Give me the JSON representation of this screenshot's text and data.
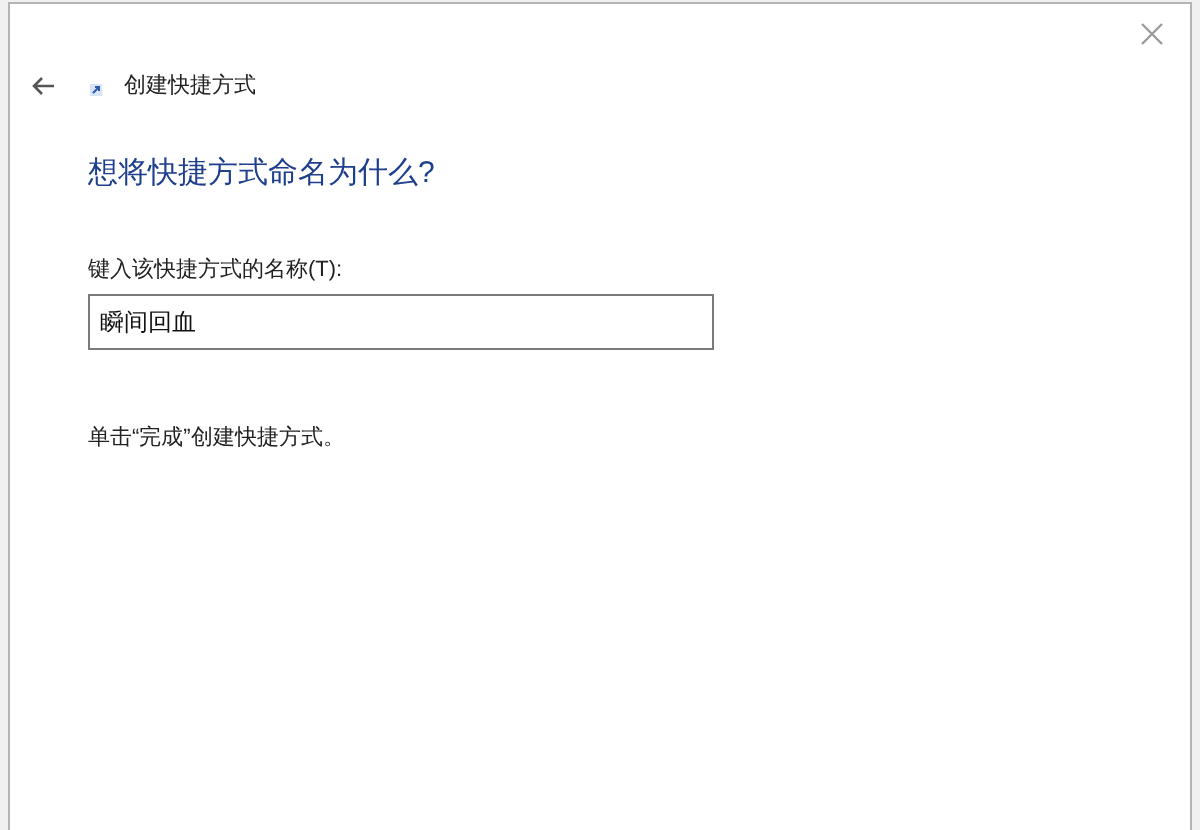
{
  "window": {
    "title": "创建快捷方式"
  },
  "heading": "想将快捷方式命名为什么?",
  "name_field": {
    "label": "键入该快捷方式的名称(T):",
    "value": "瞬间回血"
  },
  "instruction": "单击“完成”创建快捷方式。"
}
